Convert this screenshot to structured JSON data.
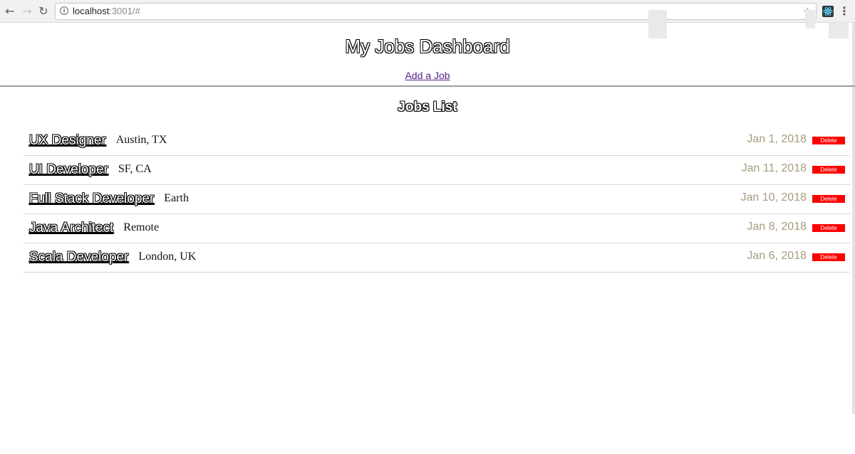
{
  "browser": {
    "url_host": "localhost",
    "url_rest": ":3001/#",
    "icons": {
      "back": "back-arrow-icon",
      "forward": "forward-arrow-icon",
      "reload": "reload-icon",
      "info": "info-icon",
      "star": "star-icon",
      "extension": "react-devtools-icon",
      "menu": "menu-icon"
    }
  },
  "header": {
    "title": "My Jobs Dashboard",
    "add_link": "Add a Job"
  },
  "list": {
    "title": "Jobs List",
    "delete_label": "Delete",
    "jobs": [
      {
        "title": "UX Designer",
        "location": "Austin, TX",
        "date": "Jan 1, 2018"
      },
      {
        "title": "UI Developer",
        "location": "SF, CA",
        "date": "Jan 11, 2018"
      },
      {
        "title": "Full Stack Developer",
        "location": "Earth",
        "date": "Jan 10, 2018"
      },
      {
        "title": "Java Architect",
        "location": "Remote",
        "date": "Jan 8, 2018"
      },
      {
        "title": "Scala Developer",
        "location": "London, UK",
        "date": "Jan 6, 2018"
      }
    ]
  },
  "colors": {
    "delete_bg": "#ff0000",
    "date_text": "#a89b7f",
    "link": "#551a8b"
  }
}
